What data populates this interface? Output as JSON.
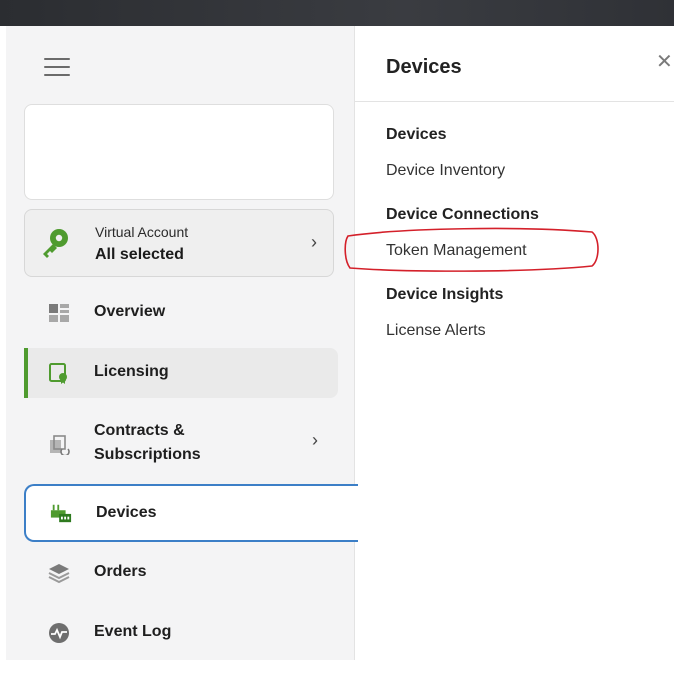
{
  "sidebar": {
    "virtual_account": {
      "label": "Virtual Account",
      "value": "All selected"
    },
    "items": [
      {
        "label": "Overview"
      },
      {
        "label": "Licensing"
      },
      {
        "label": "Contracts &",
        "label2": "Subscriptions"
      },
      {
        "label": "Devices"
      },
      {
        "label": "Orders"
      },
      {
        "label": "Event Log"
      }
    ]
  },
  "panel": {
    "title": "Devices",
    "sections": [
      {
        "heading": "Devices",
        "links": [
          "Device Inventory"
        ]
      },
      {
        "heading": "Device Connections",
        "links": [
          "Token Management"
        ]
      },
      {
        "heading": "Device Insights",
        "links": [
          "License Alerts"
        ]
      }
    ]
  },
  "colors": {
    "accent_green": "#4f9b2f",
    "active_blue": "#3c7fc7",
    "highlight_red": "#d4202a"
  },
  "icons": {
    "menu": "hamburger-icon",
    "virtual_account": "key-icon",
    "close": "close-icon"
  }
}
